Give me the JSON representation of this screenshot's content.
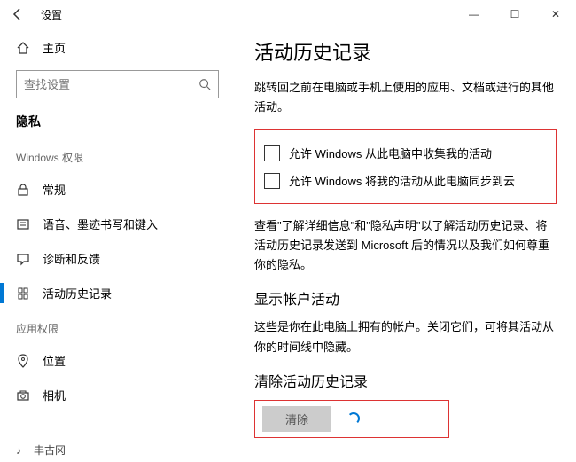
{
  "window": {
    "title": "设置",
    "min": "—",
    "max": "☐",
    "close": "✕"
  },
  "sidebar": {
    "home": "主页",
    "search_placeholder": "查找设置",
    "section": "隐私",
    "group1": "Windows 权限",
    "items1": [
      {
        "label": "常规"
      },
      {
        "label": "语音、墨迹书写和键入"
      },
      {
        "label": "诊断和反馈"
      },
      {
        "label": "活动历史记录"
      }
    ],
    "group2": "应用权限",
    "items2": [
      {
        "label": "位置"
      },
      {
        "label": "相机"
      }
    ],
    "cutoff": "丰古冈"
  },
  "main": {
    "title": "活动历史记录",
    "intro": "跳转回之前在电脑或手机上使用的应用、文档或进行的其他活动。",
    "check1": "允许 Windows 从此电脑中收集我的活动",
    "check2": "允许 Windows 将我的活动从此电脑同步到云",
    "info": "查看\"了解详细信息\"和\"隐私声明\"以了解活动历史记录、将活动历史记录发送到 Microsoft 后的情况以及我们如何尊重你的隐私。",
    "accounts_title": "显示帐户活动",
    "accounts_desc": "这些是你在此电脑上拥有的帐户。关闭它们，可将其活动从你的时间线中隐藏。",
    "clear_title": "清除活动历史记录",
    "clear_btn": "清除"
  }
}
